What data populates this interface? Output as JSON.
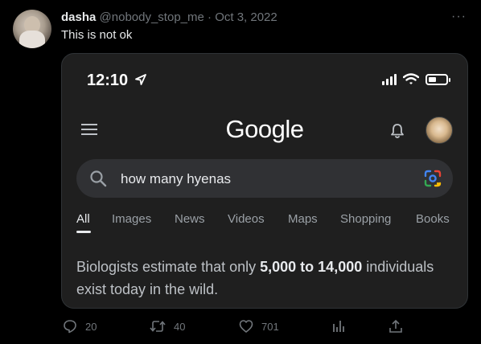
{
  "tweet": {
    "display_name": "dasha",
    "handle": "@nobody_stop_me",
    "separator": "·",
    "date": "Oct 3, 2022",
    "text": "This is not ok",
    "more_glyph": "···"
  },
  "phone": {
    "status_time": "12:10",
    "battery_level": 0.45,
    "logo": "Google",
    "search_query": "how many hyenas",
    "tabs": [
      "All",
      "Images",
      "News",
      "Videos",
      "Maps",
      "Shopping",
      "Books"
    ],
    "active_tab": "All",
    "answer_prefix": "Biologists estimate that only",
    "answer_bold": "5,000 to 14,000",
    "answer_suffix": "individuals exist today in the wild."
  },
  "actions": {
    "replies": "20",
    "retweets": "40",
    "likes": "701"
  },
  "icons": [
    "location-arrow-icon",
    "signal-icon",
    "wifi-icon",
    "battery-icon",
    "menu-icon",
    "bell-icon",
    "search-icon",
    "lens-icon",
    "reply-icon",
    "retweet-icon",
    "like-icon",
    "analytics-icon",
    "share-icon"
  ],
  "colors": {
    "background": "#000000",
    "card": "#1f1f1f",
    "search_bar": "#303134",
    "muted": "#71767b"
  }
}
